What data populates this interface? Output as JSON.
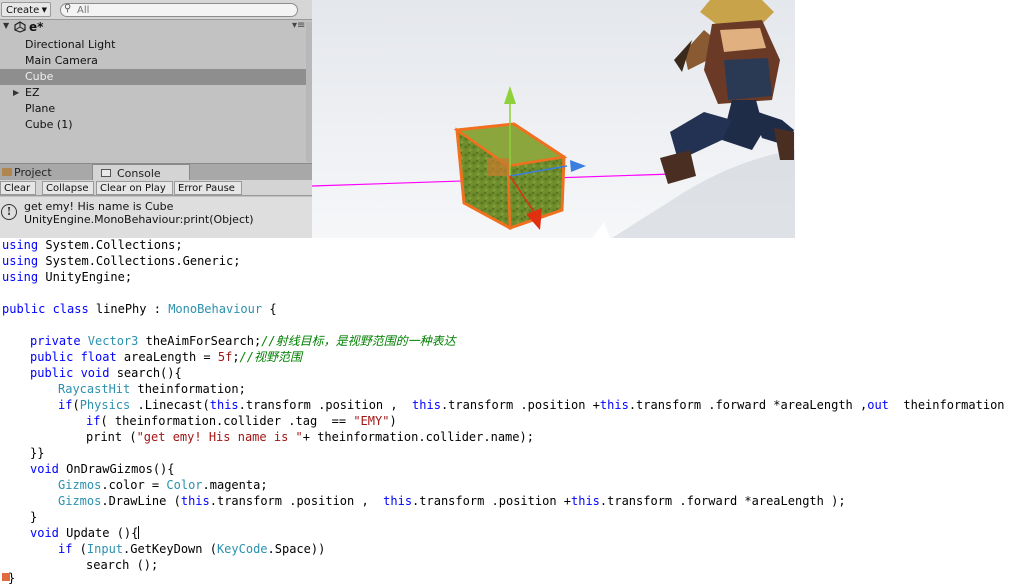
{
  "hierarchy": {
    "create_label": "Create",
    "search_placeholder": "All",
    "scene_name": "e*",
    "items": [
      {
        "label": "Directional Light"
      },
      {
        "label": "Main Camera"
      },
      {
        "label": "Cube",
        "selected": true
      },
      {
        "label": "EZ",
        "expandable": true
      },
      {
        "label": "Plane"
      },
      {
        "label": "Cube (1)"
      }
    ]
  },
  "tabs": {
    "project": "Project",
    "console": "Console"
  },
  "console": {
    "buttons": [
      "Clear",
      "Collapse",
      "Clear on Play",
      "Error Pause"
    ],
    "message_line1": "get emy! His name is Cube",
    "message_line2": "UnityEngine.MonoBehaviour:print(Object)"
  },
  "scene": {
    "gizmo_line_color": "#ff00ff",
    "selection_outline_color": "#f07020",
    "axis_colors": {
      "y": "#8ed13a",
      "x": "#e03010",
      "z": "#3a7ee0"
    }
  },
  "code": {
    "l1_kw": "using",
    "l1_rest": " System.Collections;",
    "l2_kw": "using",
    "l2_rest": " System.Collections.Generic;",
    "l3_kw": "using",
    "l3_rest": " UnityEngine;",
    "l5_kw": "public class",
    "l5_name": " linePhy : ",
    "l5_base": "MonoBehaviour",
    "l5_brace": " {",
    "l7_kw": "private",
    "l7_type": " Vector3",
    "l7_rest": " theAimForSearch;",
    "l7_comment": "//射线目标，是视野范围的一种表达",
    "l8_kw": "public float",
    "l8_rest": " areaLength = ",
    "l8_num": "5f",
    "l8_semi": ";",
    "l8_comment": "//视野范围",
    "l9_kw": "public void",
    "l9_rest": " search(){",
    "l10_type": "RaycastHit",
    "l10_rest": " theinformation;",
    "l11_kw": "if",
    "l11_a": "(",
    "l11_type": "Physics",
    "l11_b": " .Linecast(",
    "l11_this1": "this",
    "l11_c": ".transform .position ,  ",
    "l11_this2": "this",
    "l11_d": ".transform .position +",
    "l11_this3": "this",
    "l11_e": ".transform .forward *areaLength ,",
    "l11_out": "out",
    "l11_f": "  theinformation )){",
    "l12_kw": "if",
    "l12_rest": "( theinformation.collider .tag  == ",
    "l12_str": "\"EMY\"",
    "l12_end": ")",
    "l13_a": "print (",
    "l13_str": "\"get emy! His name is \"",
    "l13_b": "+ theinformation.collider.name);",
    "l14": "}}",
    "l15_kw": "void",
    "l15_rest": " OnDrawGizmos(){",
    "l16_type1": "Gizmos",
    "l16_a": ".color = ",
    "l16_type2": "Color",
    "l16_b": ".magenta;",
    "l17_type": "Gizmos",
    "l17_a": ".DrawLine (",
    "l17_this1": "this",
    "l17_b": ".transform .position ,  ",
    "l17_this2": "this",
    "l17_c": ".transform .position +",
    "l17_this3": "this",
    "l17_d": ".transform .forward *areaLength );",
    "l18": "}",
    "l19_kw": "void",
    "l19_rest": " Update (){",
    "l20_kw": "if",
    "l20_a": " (",
    "l20_type1": "Input",
    "l20_b": ".GetKeyDown (",
    "l20_type2": "KeyCode",
    "l20_c": ".Space))",
    "l21": "search ();",
    "l22": "}"
  }
}
